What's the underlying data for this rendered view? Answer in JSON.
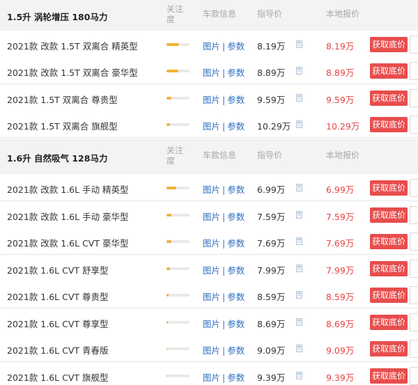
{
  "columns": {
    "attention": "关注度",
    "attention_line1": "关注",
    "attention_line2": "度",
    "info": "车款信息",
    "guide_price": "指导价",
    "local_price": "本地报价"
  },
  "link_labels": {
    "photos": "图片",
    "separator": "|",
    "params": "参数"
  },
  "button_label": "获取底价",
  "colors": {
    "accent_bar": "#f2b233",
    "price_red": "#e64545",
    "button_red": "#e84d4d",
    "link_blue": "#2f6fbf"
  },
  "icons": [
    "calculator-icon"
  ],
  "groups": [
    {
      "title": "1.5升 涡轮增压 180马力",
      "rows": [
        {
          "name": "2021款 改款 1.5T 双离合 精英型",
          "attention": 0.55,
          "guide": "8.19万",
          "local": "8.19万"
        },
        {
          "name": "2021款 改款 1.5T 双离合 豪华型",
          "attention": 0.5,
          "guide": "8.89万",
          "local": "8.89万"
        },
        {
          "name": "2021款 1.5T 双离合 尊贵型",
          "attention": 0.22,
          "guide": "9.59万",
          "local": "9.59万"
        },
        {
          "name": "2021款 1.5T 双离合 旗舰型",
          "attention": 0.16,
          "guide": "10.29万",
          "local": "10.29万"
        }
      ]
    },
    {
      "title": "1.6升 自然吸气 128马力",
      "rows": [
        {
          "name": "2021款 改款 1.6L 手动 精英型",
          "attention": 0.42,
          "guide": "6.99万",
          "local": "6.99万"
        },
        {
          "name": "2021款 改款 1.6L 手动 豪华型",
          "attention": 0.2,
          "guide": "7.59万",
          "local": "7.59万"
        },
        {
          "name": "2021款 改款 1.6L CVT 豪华型",
          "attention": 0.2,
          "guide": "7.69万",
          "local": "7.69万"
        },
        {
          "name": "2021款 1.6L CVT 舒享型",
          "attention": 0.16,
          "guide": "7.99万",
          "local": "7.99万"
        },
        {
          "name": "2021款 1.6L CVT 尊贵型",
          "attention": 0.08,
          "guide": "8.59万",
          "local": "8.59万"
        },
        {
          "name": "2021款 1.6L CVT 尊享型",
          "attention": 0.05,
          "guide": "8.69万",
          "local": "8.69万"
        },
        {
          "name": "2021款 1.6L CVT 青春版",
          "attention": 0.04,
          "guide": "9.09万",
          "local": "9.09万"
        },
        {
          "name": "2021款 1.6L CVT 旗舰型",
          "attention": 0.04,
          "guide": "9.39万",
          "local": "9.39万"
        }
      ]
    }
  ]
}
